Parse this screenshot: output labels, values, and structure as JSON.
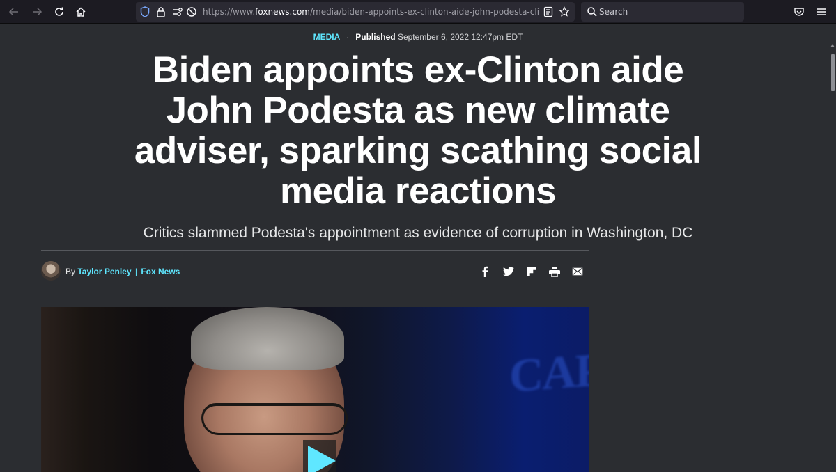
{
  "browser": {
    "url_prefix": "https://www.",
    "url_domain": "foxnews.com",
    "url_path": "/media/biden-appoints-ex-clinton-aide-john-podesta-climate-adv",
    "search_placeholder": "Search",
    "icons": [
      "back-icon",
      "forward-icon",
      "reload-icon",
      "home-icon",
      "shield-icon",
      "lock-icon",
      "permissions-icon",
      "tracking-icon",
      "reader-view-icon",
      "bookmark-star-icon",
      "search-icon",
      "pocket-icon",
      "menu-icon"
    ]
  },
  "article": {
    "eyebrow": "MEDIA",
    "separator": "·",
    "published_label": "Published",
    "published_date": "September 6, 2022 12:47pm EDT",
    "headline": "Biden appoints ex-Clinton aide John Podesta as new climate adviser, sparking scathing social media reactions",
    "subhead": "Critics slammed Podesta's appointment as evidence of corruption in Washington, DC",
    "byline_prefix": "By",
    "author": "Taylor Penley",
    "byline_separator": "|",
    "source": "Fox News",
    "share_icons": [
      "facebook-icon",
      "twitter-icon",
      "flipboard-icon",
      "print-icon",
      "email-icon"
    ],
    "hero_image_text": "CAP"
  },
  "colors": {
    "accent": "#5fe7ff",
    "page_bg": "#2b2d31",
    "toolbar_bg": "#1c1b22"
  }
}
